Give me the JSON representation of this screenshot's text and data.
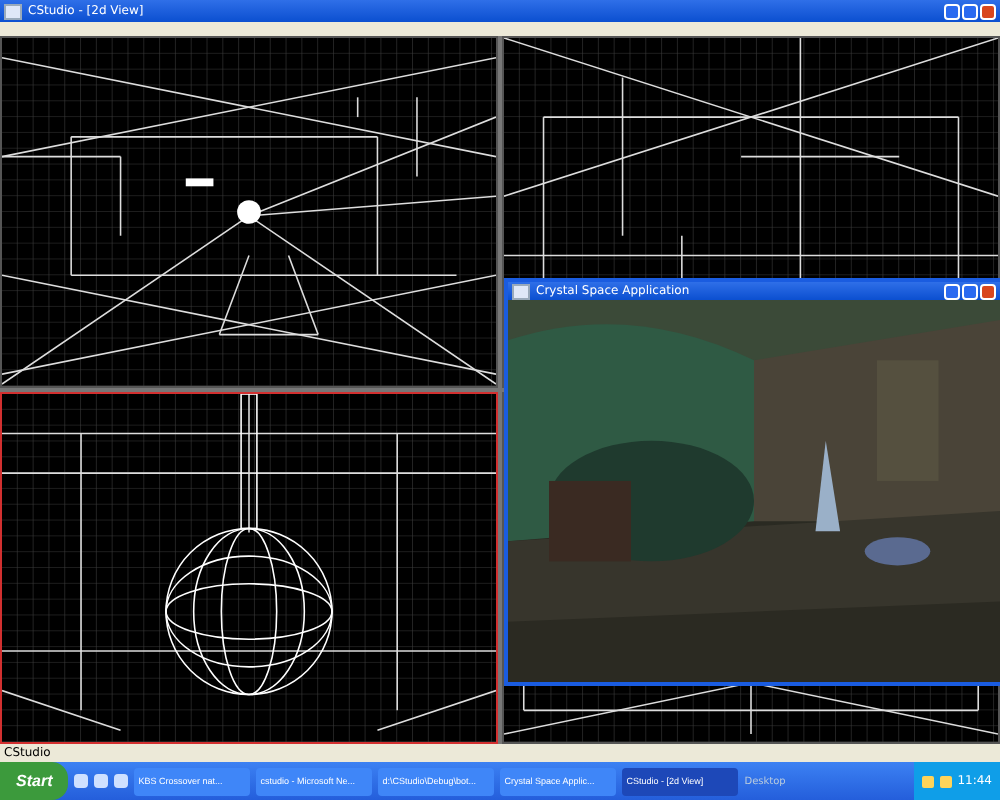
{
  "window": {
    "title": "CStudio - [2d View]"
  },
  "viewports": [
    {
      "kind": "front",
      "selected": false
    },
    {
      "kind": "top",
      "selected": false
    },
    {
      "kind": "sphere",
      "selected": true
    },
    {
      "kind": "floor",
      "selected": false
    }
  ],
  "render_window": {
    "title": "Crystal Space Application"
  },
  "status_bar": "CStudio",
  "taskbar": {
    "start": "Start",
    "tasks": [
      {
        "label": "KBS Crossover nat...",
        "selected": false
      },
      {
        "label": "cstudio - Microsoft Ne...",
        "selected": false
      },
      {
        "label": "d:\\CStudio\\Debug\\bot...",
        "selected": false
      },
      {
        "label": "Crystal Space Applic...",
        "selected": false
      },
      {
        "label": "CStudio - [2d View]",
        "selected": true
      }
    ],
    "toolbar_label": "Desktop",
    "clock": "11:44"
  }
}
